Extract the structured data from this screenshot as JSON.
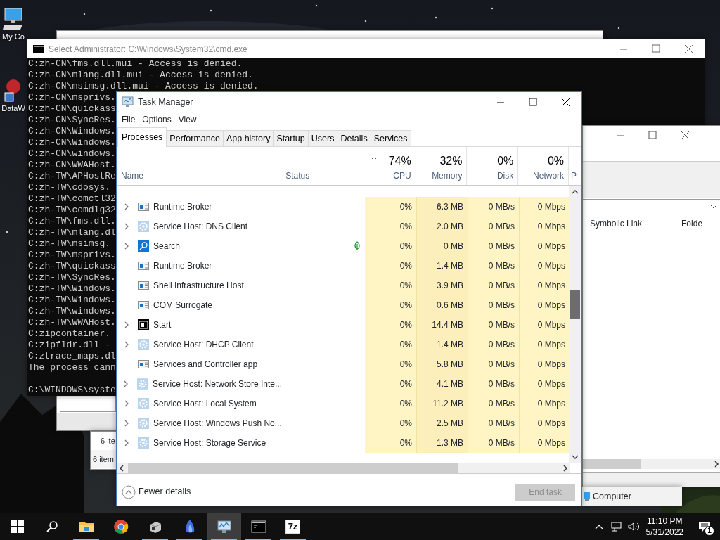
{
  "desktop": {
    "icons": [
      {
        "label": "My Co",
        "kind": "computer"
      },
      {
        "label": "DataW",
        "kind": "shortcut"
      }
    ]
  },
  "back_window": {
    "status_items": [
      "6 ite",
      "6 item"
    ]
  },
  "explorer_window": {
    "columns": [
      "Symbolic Link",
      "Folde"
    ]
  },
  "computer_window": {
    "status": "Computer"
  },
  "cmd": {
    "title": "Select Administrator: C:\\Windows\\System32\\cmd.exe",
    "lines": [
      "C:zh-CN\\fms.dll.mui - Access is denied.",
      "C:zh-CN\\mlang.dll.mui - Access is denied.",
      "C:zh-CN\\msimsg.dll.mui - Access is denied.",
      "C:zh-CN\\msprivs.",
      "C:zh-CN\\quickass",
      "C:zh-CN\\SyncRes.",
      "C:zh-CN\\Windows.",
      "C:zh-CN\\Windows.",
      "C:zh-CN\\windows.",
      "C:zh-CN\\WWAHost.",
      "C:zh-TW\\APHostRe",
      "C:zh-TW\\cdosys.",
      "C:zh-TW\\comctl32",
      "C:zh-TW\\comdlg32",
      "C:zh-TW\\fms.dll.",
      "C:zh-TW\\mlang.dl",
      "C:zh-TW\\msimsg.",
      "C:zh-TW\\msprivs.",
      "C:zh-TW\\quickass",
      "C:zh-TW\\SyncRes.",
      "C:zh-TW\\Windows.",
      "C:zh-TW\\Windows.",
      "C:zh-TW\\windows.",
      "C:zh-TW\\WWAHost.",
      "C:zipcontainer.",
      "C:zipfldr.dll -",
      "C:ztrace_maps.dl",
      "The process cann"
    ],
    "prompt": "C:\\WINDOWS\\syste"
  },
  "task_manager": {
    "title": "Task Manager",
    "menu": [
      "File",
      "Options",
      "View"
    ],
    "tabs": [
      {
        "label": "Processes",
        "selected": true
      },
      {
        "label": "Performance",
        "selected": false
      },
      {
        "label": "App history",
        "selected": false
      },
      {
        "label": "Startup",
        "selected": false
      },
      {
        "label": "Users",
        "selected": false
      },
      {
        "label": "Details",
        "selected": false
      },
      {
        "label": "Services",
        "selected": false
      }
    ],
    "columns": [
      {
        "label": "Name"
      },
      {
        "label": "Status"
      },
      {
        "label": "CPU",
        "total": "74%",
        "sorted": true
      },
      {
        "label": "Memory",
        "total": "32%",
        "sorted": false
      },
      {
        "label": "Disk",
        "total": "0%",
        "sorted": false
      },
      {
        "label": "Network",
        "total": "0%",
        "sorted": false
      },
      {
        "label": "P"
      }
    ],
    "rows": [
      {
        "name": "Runtime Broker",
        "kind": "app",
        "expandable": true,
        "suspended": false,
        "cpu": "0%",
        "memory": "6.3 MB",
        "disk": "0 MB/s",
        "network": "0 Mbps"
      },
      {
        "name": "Service Host: DNS Client",
        "kind": "service",
        "expandable": true,
        "suspended": false,
        "cpu": "0%",
        "memory": "2.0 MB",
        "disk": "0 MB/s",
        "network": "0 Mbps"
      },
      {
        "name": "Search",
        "kind": "search",
        "expandable": true,
        "suspended": true,
        "cpu": "0%",
        "memory": "0 MB",
        "disk": "0 MB/s",
        "network": "0 Mbps"
      },
      {
        "name": "Runtime Broker",
        "kind": "app",
        "expandable": false,
        "suspended": false,
        "cpu": "0%",
        "memory": "1.4 MB",
        "disk": "0 MB/s",
        "network": "0 Mbps"
      },
      {
        "name": "Shell Infrastructure Host",
        "kind": "app",
        "expandable": false,
        "suspended": false,
        "cpu": "0%",
        "memory": "3.9 MB",
        "disk": "0 MB/s",
        "network": "0 Mbps"
      },
      {
        "name": "COM Surrogate",
        "kind": "app",
        "expandable": false,
        "suspended": false,
        "cpu": "0%",
        "memory": "0.6 MB",
        "disk": "0 MB/s",
        "network": "0 Mbps"
      },
      {
        "name": "Start",
        "kind": "start",
        "expandable": true,
        "suspended": false,
        "cpu": "0%",
        "memory": "14.4 MB",
        "disk": "0 MB/s",
        "network": "0 Mbps"
      },
      {
        "name": "Service Host: DHCP Client",
        "kind": "service",
        "expandable": true,
        "suspended": false,
        "cpu": "0%",
        "memory": "1.4 MB",
        "disk": "0 MB/s",
        "network": "0 Mbps"
      },
      {
        "name": "Services and Controller app",
        "kind": "app",
        "expandable": false,
        "suspended": false,
        "cpu": "0%",
        "memory": "5.8 MB",
        "disk": "0 MB/s",
        "network": "0 Mbps"
      },
      {
        "name": "Service Host: Network Store Inte...",
        "kind": "service",
        "expandable": true,
        "suspended": false,
        "cpu": "0%",
        "memory": "4.1 MB",
        "disk": "0 MB/s",
        "network": "0 Mbps"
      },
      {
        "name": "Service Host: Local System",
        "kind": "service",
        "expandable": true,
        "suspended": false,
        "cpu": "0%",
        "memory": "11.2 MB",
        "disk": "0 MB/s",
        "network": "0 Mbps"
      },
      {
        "name": "Service Host: Windows Push No...",
        "kind": "service",
        "expandable": true,
        "suspended": false,
        "cpu": "0%",
        "memory": "2.5 MB",
        "disk": "0 MB/s",
        "network": "0 Mbps"
      },
      {
        "name": "Service Host: Storage Service",
        "kind": "service",
        "expandable": true,
        "suspended": false,
        "cpu": "0%",
        "memory": "1.3 MB",
        "disk": "0 MB/s",
        "network": "0 Mbps"
      }
    ],
    "fewer_details": "Fewer details",
    "end_task": {
      "label": "End task",
      "disabled": true
    }
  },
  "taskbar": {
    "apps": [
      {
        "kind": "explorer",
        "running": true,
        "active": false
      },
      {
        "kind": "chrome",
        "running": false,
        "active": false
      },
      {
        "kind": "package",
        "running": true,
        "active": false
      },
      {
        "kind": "flame",
        "running": true,
        "active": false
      },
      {
        "kind": "taskmgr",
        "running": true,
        "active": true
      },
      {
        "kind": "console",
        "running": true,
        "active": false
      },
      {
        "kind": "sevenzip",
        "label": "7z",
        "running": true,
        "active": false
      }
    ],
    "time": "11:10 PM",
    "date": "5/31/2022",
    "notifications": "1"
  }
}
